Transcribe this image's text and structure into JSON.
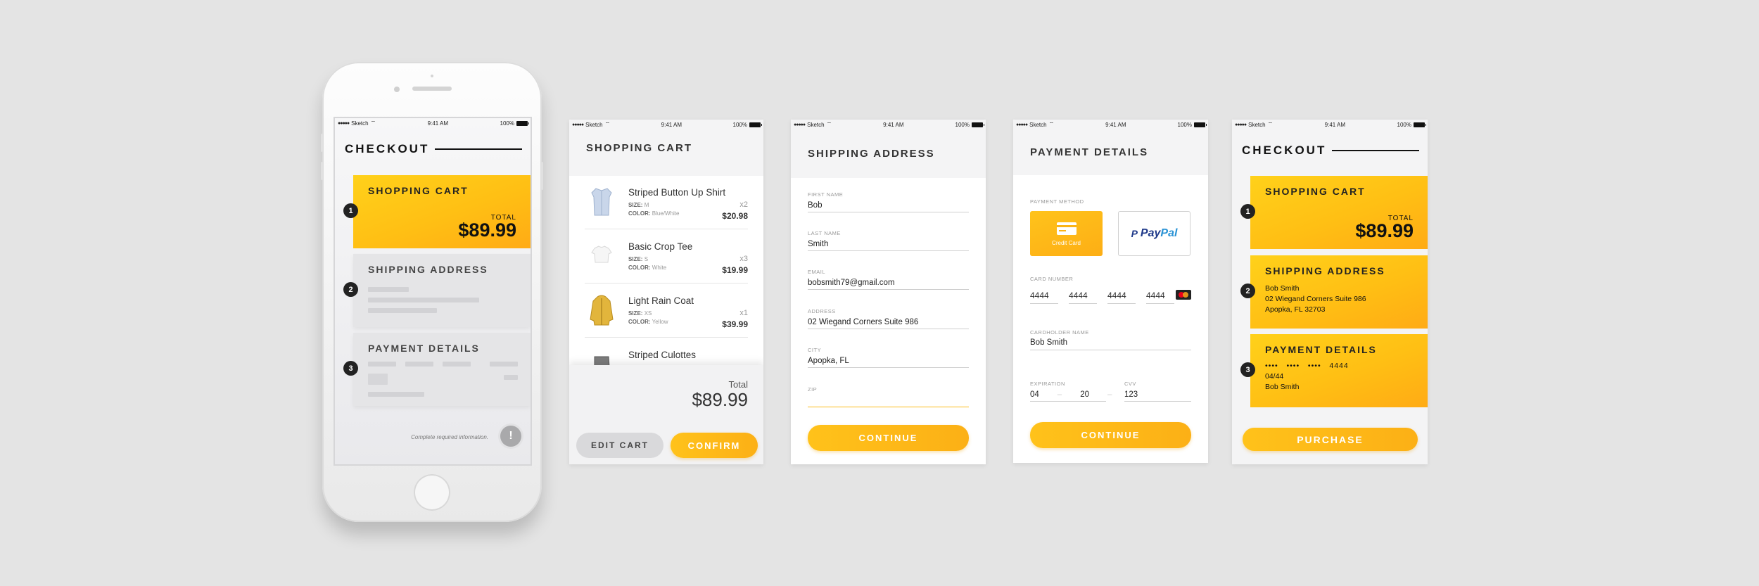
{
  "status": {
    "carrier": "Sketch",
    "time": "9:41 AM",
    "battery": "100%"
  },
  "overview": {
    "title": "CHECKOUT",
    "steps": [
      {
        "number": "1",
        "title": "SHOPPING CART",
        "total_label": "TOTAL",
        "total_value": "$89.99"
      },
      {
        "number": "2",
        "title": "SHIPPING ADDRESS"
      },
      {
        "number": "3",
        "title": "PAYMENT DETAILS"
      }
    ],
    "required_note": "Complete required information.",
    "alert_glyph": "!"
  },
  "cart": {
    "title": "SHOPPING CART",
    "size_label": "SIZE:",
    "color_label": "COLOR:",
    "items": [
      {
        "name": "Striped Button Up Shirt",
        "size": "M",
        "color": "Blue/White",
        "qty": "x2",
        "price": "$20.98"
      },
      {
        "name": "Basic Crop Tee",
        "size": "S",
        "color": "White",
        "qty": "x3",
        "price": "$19.99"
      },
      {
        "name": "Light Rain Coat",
        "size": "XS",
        "color": "Yellow",
        "qty": "x1",
        "price": "$39.99"
      },
      {
        "name": "Striped Culottes",
        "size": "",
        "color": "",
        "qty": "",
        "price": ""
      }
    ],
    "total_label": "Total",
    "total_value": "$89.99",
    "edit_label": "EDIT CART",
    "confirm_label": "CONFIRM"
  },
  "shipping": {
    "title": "SHIPPING ADDRESS",
    "fields": [
      {
        "label": "FIRST NAME",
        "value": "Bob"
      },
      {
        "label": "LAST NAME",
        "value": "Smith"
      },
      {
        "label": "EMAIL",
        "value": "bobsmith79@gmail.com"
      },
      {
        "label": "ADDRESS",
        "value": "02 Wiegand Corners Suite 986"
      },
      {
        "label": "CITY",
        "value": "Apopka, FL"
      },
      {
        "label": "ZIP",
        "value": ""
      }
    ],
    "continue_label": "CONTINUE"
  },
  "payment": {
    "title": "PAYMENT DETAILS",
    "method_label": "PAYMENT METHOD",
    "credit_card_label": "Credit Card",
    "paypal_label_1": "Pay",
    "paypal_label_2": "Pal",
    "card_number_label": "CARD NUMBER",
    "card_groups": [
      "4444",
      "4444",
      "4444",
      "4444"
    ],
    "cardholder_label": "CARDHOLDER NAME",
    "cardholder_value": "Bob Smith",
    "expiration_label": "EXPIRATION",
    "exp_month": "04",
    "exp_year": "20",
    "cvv_label": "CVV",
    "cvv_value": "123",
    "continue_label": "CONTINUE"
  },
  "review": {
    "title": "CHECKOUT",
    "cart_title": "SHOPPING CART",
    "total_label": "TOTAL",
    "total_value": "$89.99",
    "shipping_title": "SHIPPING ADDRESS",
    "shipping_lines": [
      "Bob Smith",
      "02 Wiegand Corners Suite 986",
      "Apopka, FL 32703"
    ],
    "payment_title": "PAYMENT DETAILS",
    "masked_card": "••••   ••••   ••••   4444",
    "payment_exp": "04/44",
    "payment_name": "Bob Smith",
    "purchase_label": "PURCHASE"
  },
  "colors": {
    "accent": "#ffbf14",
    "background": "#e4e4e4",
    "dark": "#222222"
  }
}
